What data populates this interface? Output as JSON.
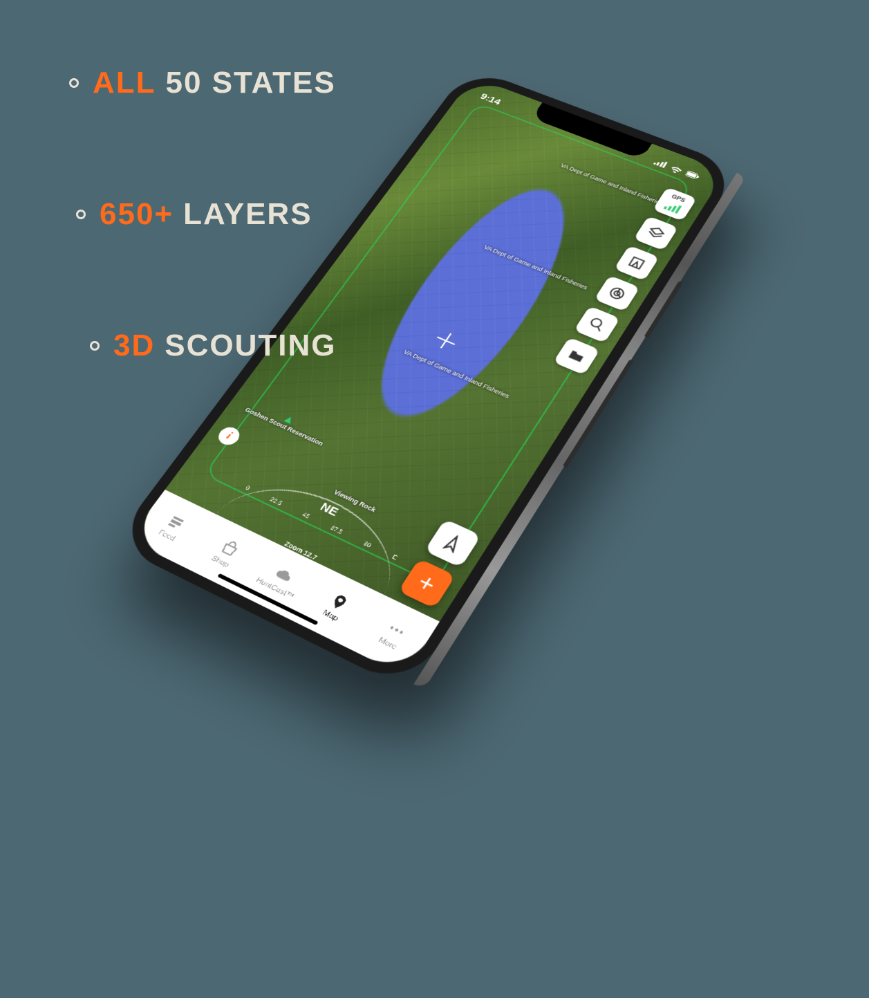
{
  "callouts": [
    {
      "accent": "ALL",
      "rest": "50 STATES"
    },
    {
      "accent": "650+",
      "rest": "LAYERS"
    },
    {
      "accent": "3D",
      "rest": "SCOUTING"
    }
  ],
  "status": {
    "time": "9:14"
  },
  "map": {
    "owner_label": "VA Dept of Game and Inland Fisheries",
    "poi_goshen": "Goshen Scout Reservation",
    "poi_viewing": "Viewing Rock"
  },
  "tools": {
    "gps": "GPS",
    "layers": "Layers",
    "basemap": "Basemap",
    "tracking": "Tracking",
    "search": "Search",
    "folders": "Folders"
  },
  "compass": {
    "direction": "NE",
    "ticks": [
      "0",
      "22.5",
      "45",
      "67.5",
      "90"
    ],
    "zoom": "Zoom 12.7",
    "east": "E"
  },
  "fab": {
    "plus": "+"
  },
  "nav": {
    "items": [
      {
        "label": "Feed"
      },
      {
        "label": "Shop"
      },
      {
        "label": "HuntCast™"
      },
      {
        "label": "Map"
      },
      {
        "label": "More"
      }
    ],
    "active_index": 3
  }
}
